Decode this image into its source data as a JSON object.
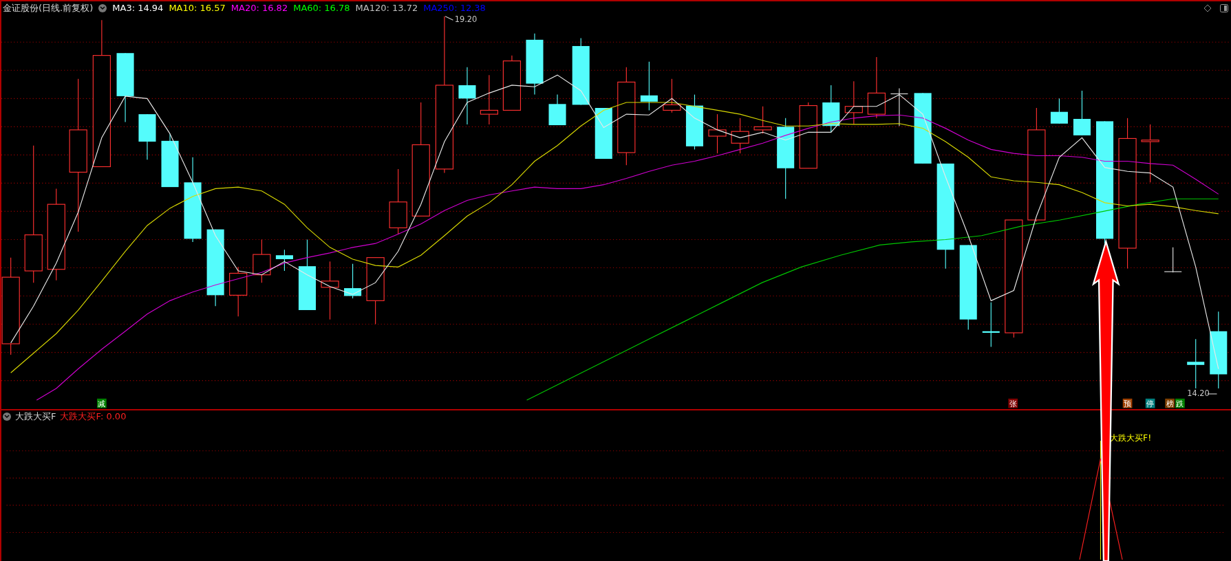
{
  "header": {
    "title": "金证股份(日线.前复权)",
    "indicators": [
      {
        "label": "MA3: 14.94",
        "color": "#ffffff"
      },
      {
        "label": "MA10: 16.57",
        "color": "#ffff00"
      },
      {
        "label": "MA20: 16.82",
        "color": "#ff00ff"
      },
      {
        "label": "MA60: 16.78",
        "color": "#00ff00"
      },
      {
        "label": "MA120: 13.72",
        "color": "#c0c0c0"
      },
      {
        "label": "MA250: 12.38",
        "color": "#0000ff"
      }
    ]
  },
  "main_chart": {
    "price_labels": [
      "19.20",
      "14.20"
    ],
    "signals": [
      {
        "text": "减",
        "color": "#008000"
      },
      {
        "text": "张",
        "color": "#800000"
      },
      {
        "text": "预",
        "color": "#a04000"
      },
      {
        "text": "停",
        "color": "#008080"
      },
      {
        "text": "榜",
        "color": "#804000"
      },
      {
        "text": "跌",
        "color": "#008000"
      }
    ]
  },
  "sub_panel": {
    "title": "大跌大买F",
    "value": "大跌大买F: 0.00",
    "signal": "大跌大买F!"
  }
}
